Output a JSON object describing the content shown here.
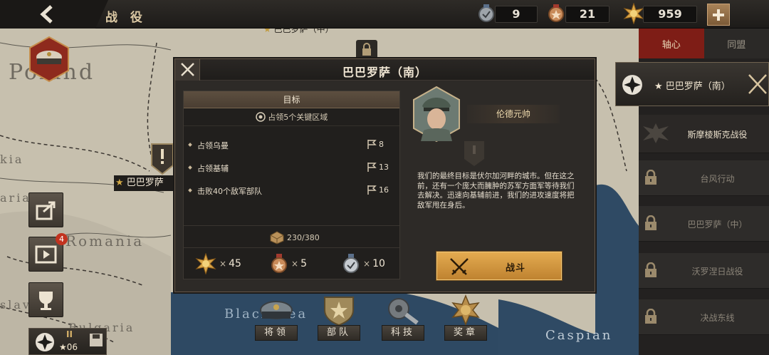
{
  "topbar": {
    "back_icon": "chevron-left-icon",
    "title": "战 役",
    "resources": [
      {
        "icon": "silver-medal-icon",
        "value": "9"
      },
      {
        "icon": "bronze-medal-icon",
        "value": "21"
      },
      {
        "icon": "gold-star-medal-icon",
        "value": "959"
      }
    ],
    "add_icon": "plus-icon"
  },
  "map": {
    "labels": [
      "Poland",
      "Romania",
      "Bulgaria",
      "Black Sea",
      "Caspian",
      "kia",
      "aria",
      "slav"
    ],
    "markers": [
      "巴巴罗萨（中）",
      "巴巴罗萨",
      "沃罗涅日战役"
    ]
  },
  "left_badge": {
    "notification_count": "4"
  },
  "player": {
    "rank": "II",
    "level": "★06"
  },
  "right_panel": {
    "tabs": [
      {
        "label": "轴心",
        "active": true
      },
      {
        "label": "同盟",
        "active": false
      }
    ],
    "selected": {
      "label": "★ 巴巴罗萨（南）"
    },
    "campaigns": [
      {
        "label": "斯摩棱斯克战役",
        "locked": false
      },
      {
        "label": "台风行动",
        "locked": true
      },
      {
        "label": "巴巴罗萨（中）",
        "locked": true
      },
      {
        "label": "沃罗涅日战役",
        "locked": true
      },
      {
        "label": "决战东线",
        "locked": true
      }
    ]
  },
  "dialog": {
    "title": "巴巴罗萨（南）",
    "objectives": {
      "header": "目标",
      "subtitle": "占领5个关键区域",
      "items": [
        {
          "text": "占领乌曼",
          "count": "8"
        },
        {
          "text": "占领基辅",
          "count": "13"
        },
        {
          "text": "击败40个敌军部队",
          "count": "16"
        }
      ],
      "progress": "230/380",
      "rewards": [
        {
          "icon": "gold-star-medal-icon",
          "amount": "45"
        },
        {
          "icon": "bronze-medal-icon",
          "amount": "5"
        },
        {
          "icon": "silver-medal-icon",
          "amount": "10"
        }
      ],
      "times": "×"
    },
    "commander": {
      "name": "伦德元帅"
    },
    "briefing": "我们的最终目标是伏尔加河畔的城市。但在这之前，还有一个庞大而臃肿的苏军方面军等待我们去解决。迅速向基辅前进，我们的进攻速度将把敌军甩在身后。",
    "fight_label": "战斗"
  },
  "bottom_nav": [
    {
      "label": "将领",
      "icon": "general-cap-icon"
    },
    {
      "label": "部队",
      "icon": "unit-shield-icon"
    },
    {
      "label": "科技",
      "icon": "gear-wrench-icon"
    },
    {
      "label": "奖章",
      "icon": "medal-icon"
    }
  ]
}
